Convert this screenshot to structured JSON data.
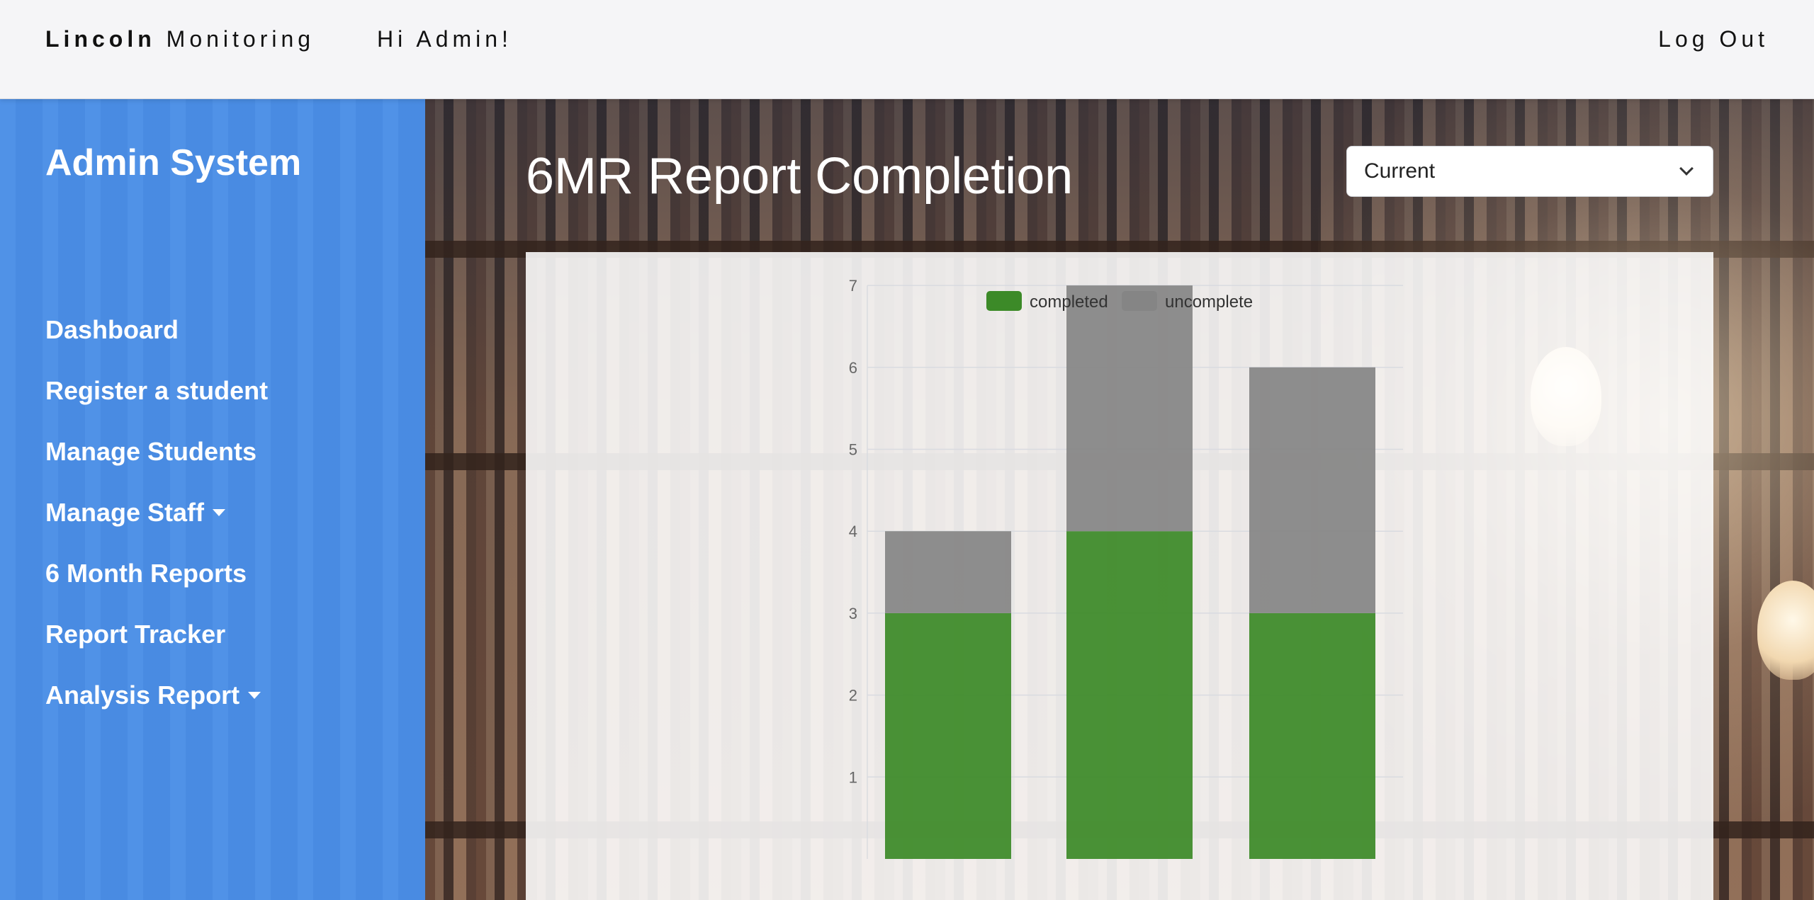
{
  "topbar": {
    "brand_bold": "Lincoln",
    "brand_rest": "Monitoring",
    "greeting": "Hi Admin!",
    "logout": "Log Out"
  },
  "sidebar": {
    "title": "Admin System",
    "items": [
      {
        "label": "Dashboard",
        "dropdown": false
      },
      {
        "label": "Register a student",
        "dropdown": false
      },
      {
        "label": "Manage Students",
        "dropdown": false
      },
      {
        "label": "Manage Staff",
        "dropdown": true
      },
      {
        "label": "6 Month Reports",
        "dropdown": false
      },
      {
        "label": "Report Tracker",
        "dropdown": false
      },
      {
        "label": "Analysis Report",
        "dropdown": true
      }
    ]
  },
  "main": {
    "title": "6MR Report Completion",
    "period_select": {
      "value": "Current"
    }
  },
  "colors": {
    "sidebar": "#4a8ee6",
    "completed": "#3c8a28",
    "uncomplete": "#858585"
  },
  "chart_data": {
    "type": "bar",
    "stacked": true,
    "categories": [
      "",
      "",
      ""
    ],
    "series": [
      {
        "name": "completed",
        "color": "#3c8a28",
        "values": [
          3,
          4,
          3
        ]
      },
      {
        "name": "uncomplete",
        "color": "#858585",
        "values": [
          1,
          3,
          3
        ]
      }
    ],
    "y_ticks": [
      1,
      2,
      3,
      4,
      5,
      6,
      7
    ],
    "ylim": [
      0,
      7
    ],
    "legend": "top",
    "grid": true
  }
}
